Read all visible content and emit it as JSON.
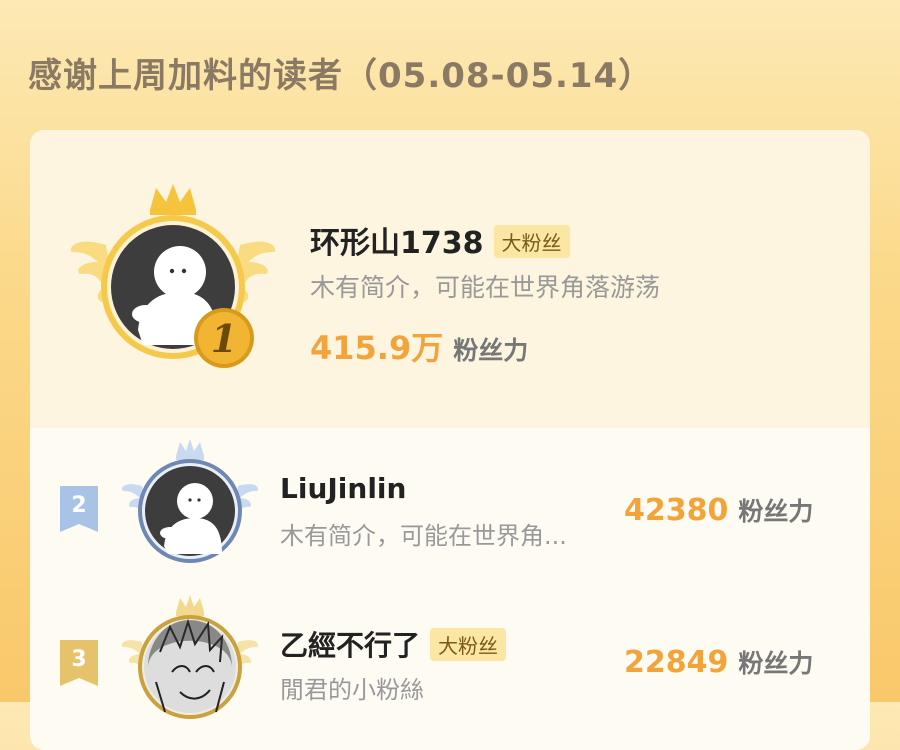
{
  "header": {
    "title": "感谢上周加料的读者（05.08-05.14）"
  },
  "leader": {
    "name": "环形山1738",
    "badge": "大粉丝",
    "bio": "木有简介，可能在世界角落游荡",
    "fans_value": "415.9万",
    "fans_label": "粉丝力",
    "rank": "1"
  },
  "list": [
    {
      "rank": "2",
      "name": "LiuJinlin",
      "badge": "",
      "bio": "木有简介，可能在世界角...",
      "fans_value": "42380",
      "fans_label": "粉丝力"
    },
    {
      "rank": "3",
      "name": "乙經不行了",
      "badge": "大粉丝",
      "bio": "閒君的小粉絲",
      "fans_value": "22849",
      "fans_label": "粉丝力"
    }
  ],
  "colors": {
    "gold": "#f2a33a",
    "silver": "#9db7d8",
    "bronze": "#e8c56a",
    "title": "#8b7a63"
  },
  "icons": [
    "crown-icon",
    "wings-icon",
    "default-avatar-icon",
    "rank-medal-icon"
  ]
}
